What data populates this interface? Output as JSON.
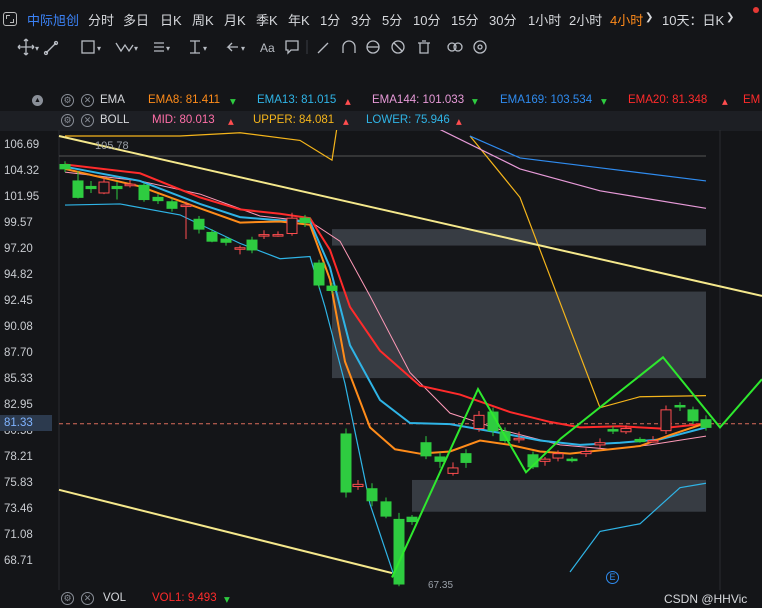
{
  "toolbar": {
    "stock_name": "中际旭创",
    "timeframes": [
      "分时",
      "多日",
      "日K",
      "周K",
      "月K",
      "季K",
      "年K",
      "1分",
      "3分",
      "5分",
      "10分",
      "15分",
      "30分",
      "1小时",
      "2小时",
      "4小时",
      "10天：日K"
    ],
    "active_timeframe": "4小时"
  },
  "drawing_tools": [
    "move-icon",
    "line-icon",
    "rect-icon",
    "wave-icon",
    "channel-icon",
    "ruler-icon",
    "arrow-icon",
    "text-icon",
    "comment-icon",
    "pen-icon",
    "magnet-icon",
    "rotate-icon",
    "hide-icon",
    "delete-icon",
    "link-icon",
    "settings-icon"
  ],
  "ema_legend": {
    "name": "EMA",
    "items": [
      {
        "label": "EMA8:",
        "value": "81.411",
        "dir": "down",
        "color": "#ff8c1a"
      },
      {
        "label": "EMA13:",
        "value": "81.015",
        "dir": "up",
        "color": "#2fb4e6"
      },
      {
        "label": "EMA144:",
        "value": "101.033",
        "dir": "down",
        "color": "#e79ad8"
      },
      {
        "label": "EMA169:",
        "value": "103.534",
        "dir": "down",
        "color": "#2f8cf0"
      },
      {
        "label": "EMA20:",
        "value": "81.348",
        "dir": "up",
        "color": "#ff2b2b"
      }
    ],
    "truncated": "EM"
  },
  "boll_legend": {
    "name": "BOLL",
    "items": [
      {
        "label": "MID:",
        "value": "80.013",
        "dir": "up",
        "color": "#ff6fa8"
      },
      {
        "label": "UPPER:",
        "value": "84.081",
        "dir": "up",
        "color": "#f5b51b"
      },
      {
        "label": "LOWER:",
        "value": "75.946",
        "dir": "up",
        "color": "#2fb4e6"
      }
    ]
  },
  "y_axis_labels": [
    "106.69",
    "104.32",
    "101.95",
    "99.57",
    "97.20",
    "94.82",
    "92.45",
    "90.08",
    "87.70",
    "85.33",
    "82.95",
    "80.58",
    "78.21",
    "75.83",
    "73.46",
    "71.08",
    "68.71"
  ],
  "current_price": "81.33",
  "high_marker": "105.78",
  "low_marker": "67.35",
  "vol_legend": {
    "name": "VOL",
    "label": "VOL1:",
    "value": "9.493",
    "dir": "down"
  },
  "watermark": "CSDN @HHVic",
  "colors": {
    "up": "#ff4d4f",
    "down": "#2ecc40",
    "background": "#141518"
  }
}
